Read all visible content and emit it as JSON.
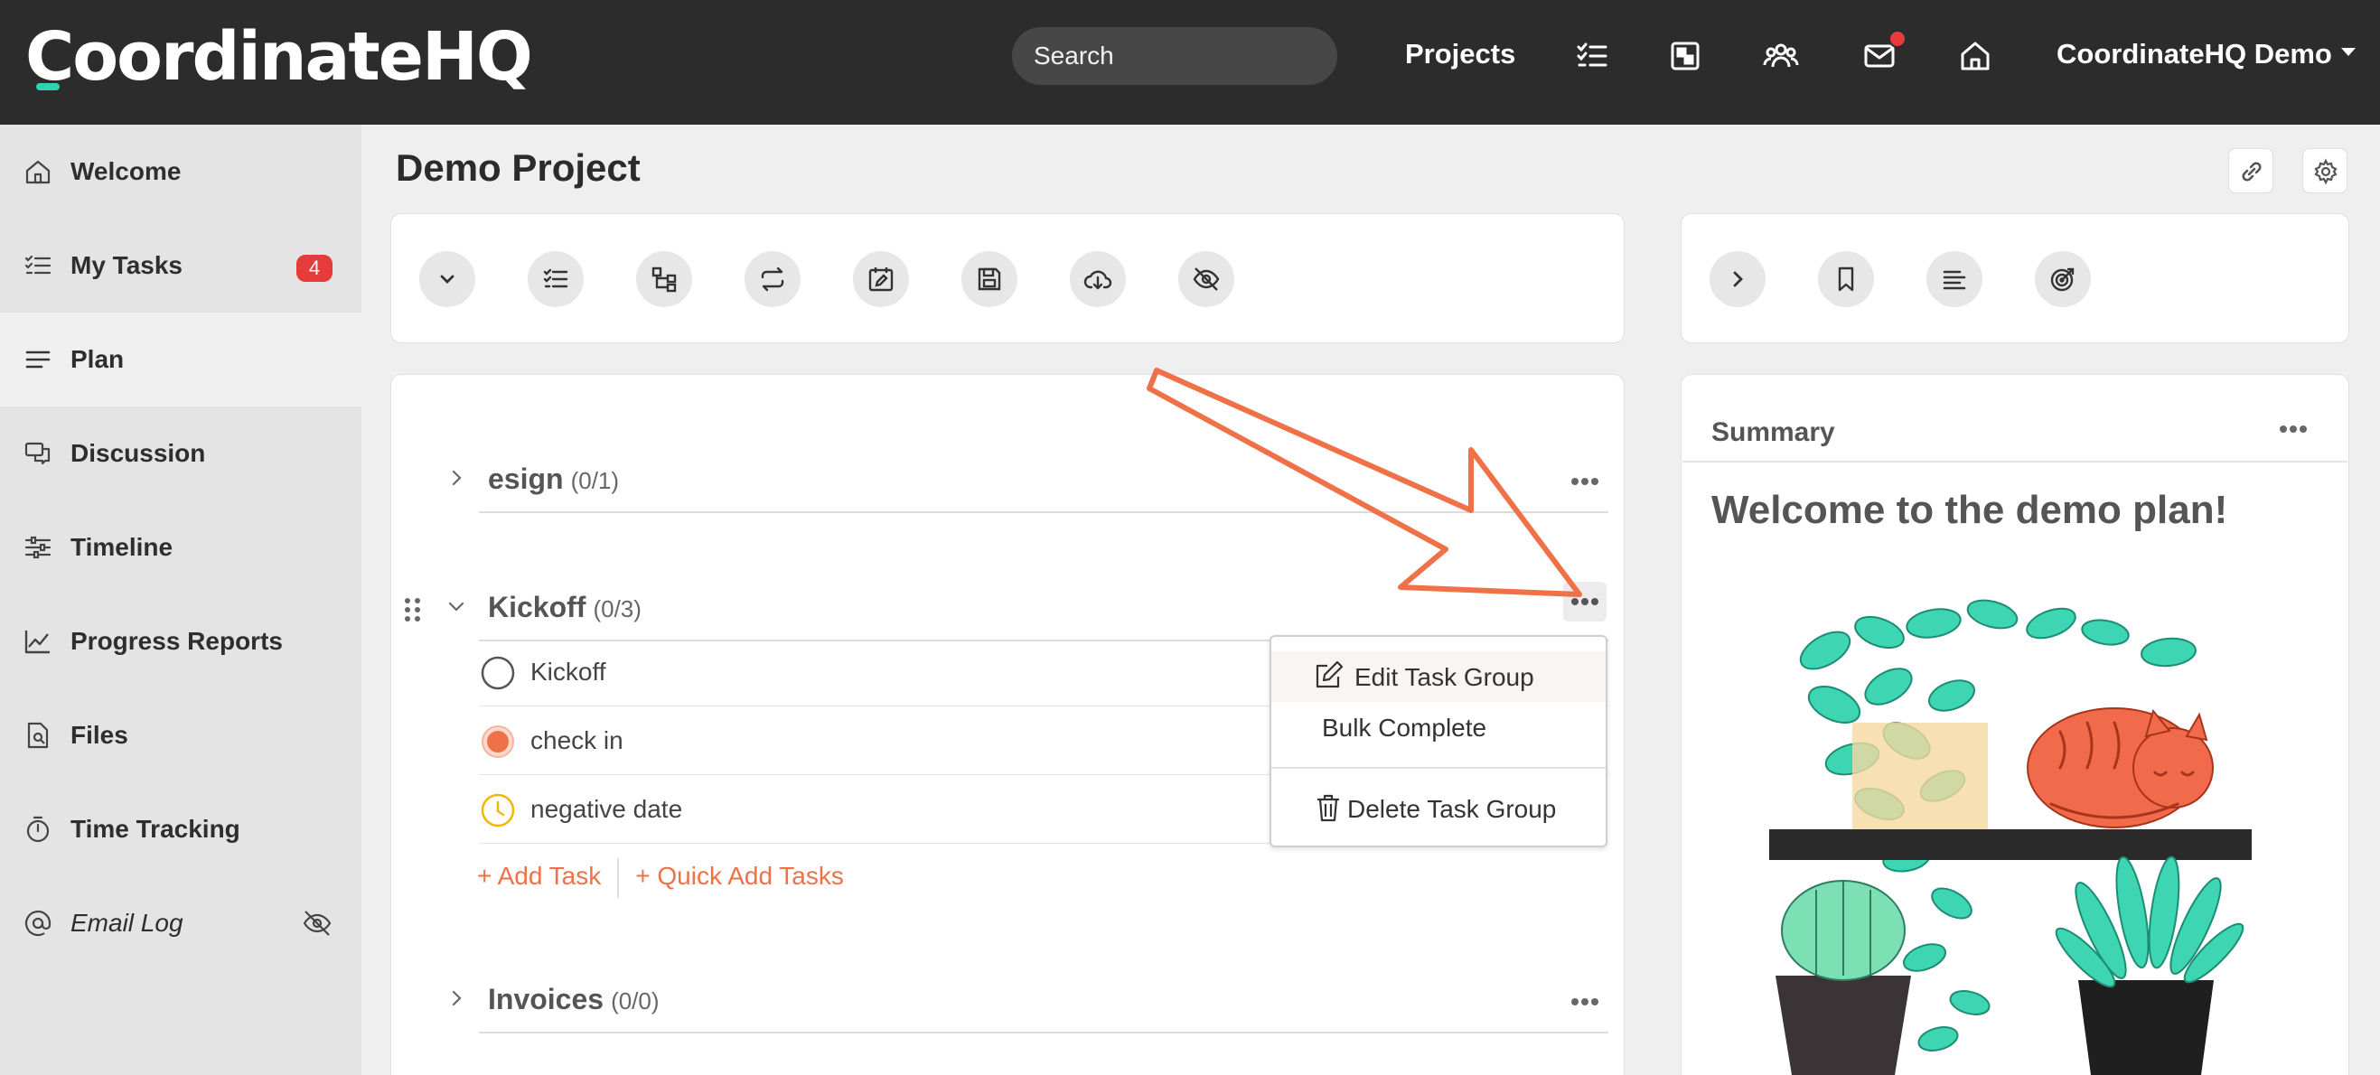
{
  "header": {
    "logo": "CoordinateHQ",
    "search_placeholder": "Search",
    "projects_label": "Projects",
    "user_label": "CoordinateHQ Demo",
    "icons": [
      "tasks-icon",
      "board-icon",
      "people-icon",
      "mail-icon",
      "home-icon"
    ],
    "notification_color": "#e53b3b"
  },
  "sidebar": {
    "items": [
      {
        "label": "Welcome",
        "icon": "home-icon"
      },
      {
        "label": "My Tasks",
        "icon": "tasks-icon",
        "badge": "4"
      },
      {
        "label": "Plan",
        "icon": "list-icon",
        "active": true
      },
      {
        "label": "Discussion",
        "icon": "chat-icon"
      },
      {
        "label": "Timeline",
        "icon": "sliders-icon"
      },
      {
        "label": "Progress Reports",
        "icon": "chart-icon"
      },
      {
        "label": "Files",
        "icon": "file-search-icon"
      },
      {
        "label": "Time Tracking",
        "icon": "stopwatch-icon"
      },
      {
        "label": "Email Log",
        "icon": "at-icon",
        "hidden_icon": "eye-slash-icon"
      }
    ]
  },
  "page": {
    "title": "Demo Project"
  },
  "toolbar": {
    "left_icons": [
      "chevron-down-icon",
      "checklist-icon",
      "hierarchy-icon",
      "repeat-icon",
      "calendar-edit-icon",
      "save-icon",
      "cloud-download-icon",
      "eye-slash-icon"
    ],
    "right_icons": [
      "chevron-right-icon",
      "bookmark-icon",
      "align-left-icon",
      "target-icon"
    ]
  },
  "plan": {
    "groups": [
      {
        "name": "esign",
        "count": "(0/1)",
        "expanded": false
      },
      {
        "name": "Kickoff",
        "count": "(0/3)",
        "expanded": true,
        "tasks": [
          {
            "label": "Kickoff",
            "status": "open"
          },
          {
            "label": "check in",
            "status": "in-progress"
          },
          {
            "label": "negative date",
            "status": "waiting"
          }
        ]
      },
      {
        "name": "Invoices",
        "count": "(0/0)",
        "expanded": false
      }
    ],
    "add_task": "+ Add Task",
    "quick_add": "+ Quick Add Tasks"
  },
  "group_menu": {
    "edit": "Edit Task Group",
    "bulk": "Bulk Complete",
    "delete": "Delete Task Group"
  },
  "summary": {
    "title": "Summary",
    "heading": "Welcome to the demo plan!"
  },
  "colors": {
    "accent": "#ee7147",
    "teal": "#2ed3b0",
    "topbar": "#2c2c2c",
    "waiting": "#f2b705"
  }
}
